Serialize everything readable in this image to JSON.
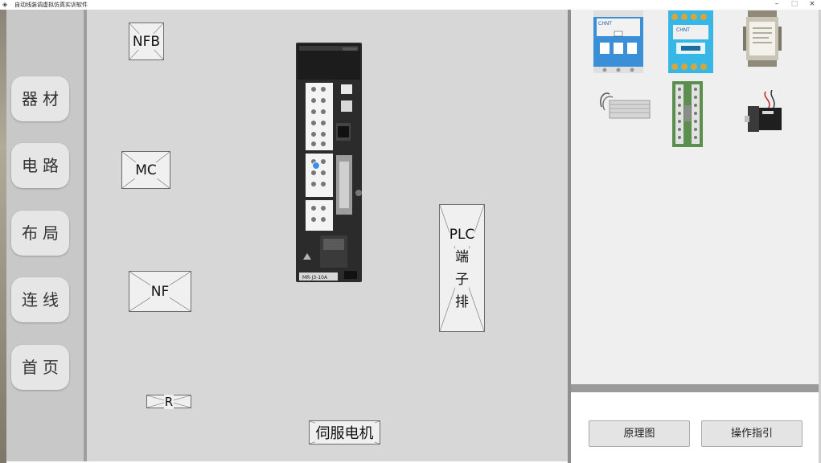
{
  "window": {
    "title": "自动线装调虚拟仿真实训软件",
    "minimize": "–",
    "maximize": "□",
    "close": "×"
  },
  "sidebar": {
    "items": [
      {
        "label": "器材"
      },
      {
        "label": "电路"
      },
      {
        "label": "布局"
      },
      {
        "label": "连线"
      },
      {
        "label": "首页"
      }
    ]
  },
  "canvas": {
    "components": {
      "nfb": "NFB",
      "mc": "MC",
      "nf": "NF",
      "r": "R",
      "plc": [
        "PLC",
        "端",
        "子",
        "排"
      ],
      "servo_motor": "伺服电机"
    },
    "driver": {
      "model": "MR-J3-10A",
      "brand": "MITSUBISHI"
    }
  },
  "parts_panel": {
    "items": [
      {
        "name": "circuit-breaker",
        "brand": "CHNT"
      },
      {
        "name": "contactor",
        "brand": "CHNT"
      },
      {
        "name": "noise-filter"
      },
      {
        "name": "brake-resistor"
      },
      {
        "name": "terminal-board"
      },
      {
        "name": "servo-motor"
      }
    ]
  },
  "bottom_panel": {
    "schematic_button": "原理图",
    "guide_button": "操作指引"
  },
  "colors": {
    "canvas_bg": "#d7d7d7",
    "sidebar_bg": "#c8c8c8",
    "panel_bg": "#efefef",
    "breaker_blue": "#3a8fd6",
    "contactor_cyan": "#36b7e6",
    "board_green": "#5a8f4e"
  }
}
